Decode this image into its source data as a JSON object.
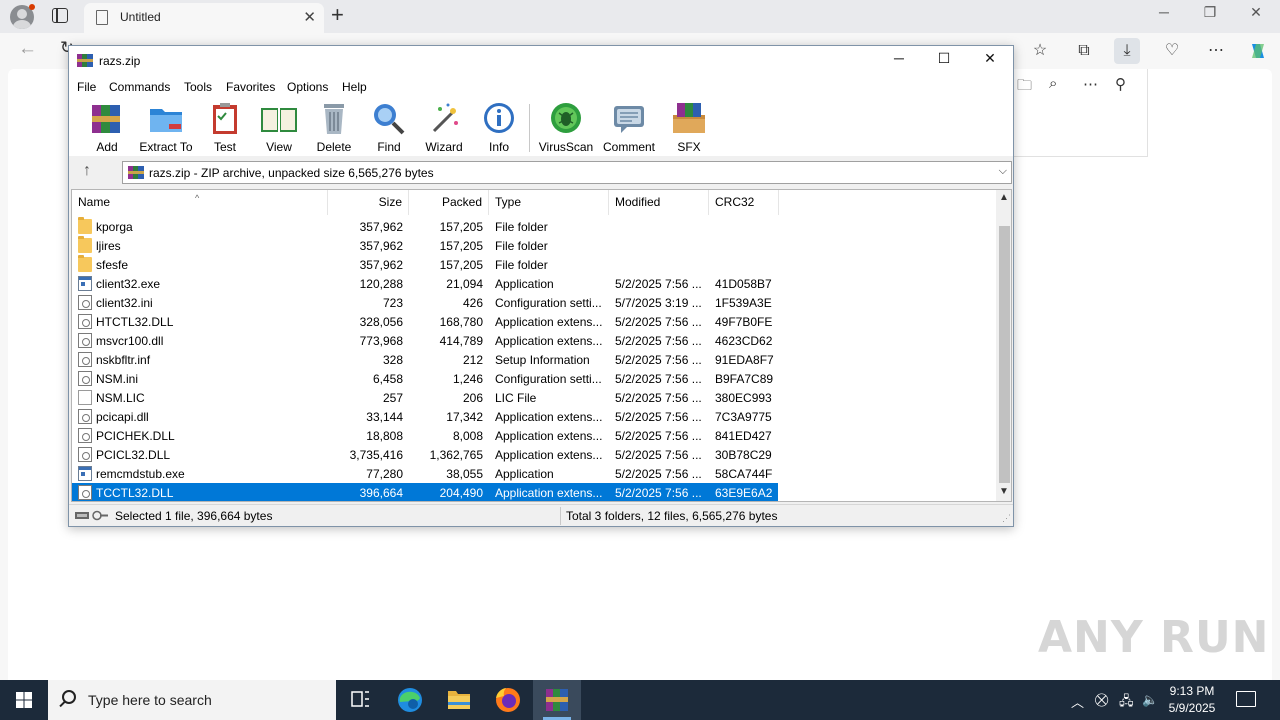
{
  "browser": {
    "tab_title": "Untitled",
    "tab_close": "✕",
    "new_tab": "+",
    "min": "─",
    "max": "❐",
    "close": "✕",
    "back": "←",
    "refresh": "↻"
  },
  "winrar": {
    "title": "razs.zip",
    "window_controls": {
      "minimize": "─",
      "maximize": "☐",
      "close": "✕"
    },
    "menu": [
      "File",
      "Commands",
      "Tools",
      "Favorites",
      "Options",
      "Help"
    ],
    "toolbar": [
      "Add",
      "Extract To",
      "Test",
      "View",
      "Delete",
      "Find",
      "Wizard",
      "Info",
      "VirusScan",
      "Comment",
      "SFX"
    ],
    "path": "razs.zip - ZIP archive, unpacked size 6,565,276 bytes",
    "columns": [
      "Name",
      "Size",
      "Packed",
      "Type",
      "Modified",
      "CRC32"
    ],
    "rows": [
      {
        "icon": "folder-icon",
        "name": "kporga",
        "size": "357,962",
        "packed": "157,205",
        "type": "File folder",
        "modified": "",
        "crc": ""
      },
      {
        "icon": "folder-icon",
        "name": "ljires",
        "size": "357,962",
        "packed": "157,205",
        "type": "File folder",
        "modified": "",
        "crc": ""
      },
      {
        "icon": "folder-icon",
        "name": "sfesfe",
        "size": "357,962",
        "packed": "157,205",
        "type": "File folder",
        "modified": "",
        "crc": ""
      },
      {
        "icon": "application-icon",
        "name": "client32.exe",
        "size": "120,288",
        "packed": "21,094",
        "type": "Application",
        "modified": "5/2/2025 7:56 ...",
        "crc": "41D058B7"
      },
      {
        "icon": "config-file-icon",
        "name": "client32.ini",
        "size": "723",
        "packed": "426",
        "type": "Configuration setti...",
        "modified": "5/7/2025 3:19 ...",
        "crc": "1F539A3E"
      },
      {
        "icon": "dll-file-icon",
        "name": "HTCTL32.DLL",
        "size": "328,056",
        "packed": "168,780",
        "type": "Application extens...",
        "modified": "5/2/2025 7:56 ...",
        "crc": "49F7B0FE"
      },
      {
        "icon": "dll-file-icon",
        "name": "msvcr100.dll",
        "size": "773,968",
        "packed": "414,789",
        "type": "Application extens...",
        "modified": "5/2/2025 7:56 ...",
        "crc": "4623CD62"
      },
      {
        "icon": "config-file-icon",
        "name": "nskbfltr.inf",
        "size": "328",
        "packed": "212",
        "type": "Setup Information",
        "modified": "5/2/2025 7:56 ...",
        "crc": "91EDA8F7"
      },
      {
        "icon": "config-file-icon",
        "name": "NSM.ini",
        "size": "6,458",
        "packed": "1,246",
        "type": "Configuration setti...",
        "modified": "5/2/2025 7:56 ...",
        "crc": "B9FA7C89"
      },
      {
        "icon": "blank-file-icon",
        "name": "NSM.LIC",
        "size": "257",
        "packed": "206",
        "type": "LIC File",
        "modified": "5/2/2025 7:56 ...",
        "crc": "380EC993"
      },
      {
        "icon": "dll-file-icon",
        "name": "pcicapi.dll",
        "size": "33,144",
        "packed": "17,342",
        "type": "Application extens...",
        "modified": "5/2/2025 7:56 ...",
        "crc": "7C3A9775"
      },
      {
        "icon": "dll-file-icon",
        "name": "PCICHEK.DLL",
        "size": "18,808",
        "packed": "8,008",
        "type": "Application extens...",
        "modified": "5/2/2025 7:56 ...",
        "crc": "841ED427"
      },
      {
        "icon": "dll-file-icon",
        "name": "PCICL32.DLL",
        "size": "3,735,416",
        "packed": "1,362,765",
        "type": "Application extens...",
        "modified": "5/2/2025 7:56 ...",
        "crc": "30B78C29"
      },
      {
        "icon": "application-icon",
        "name": "remcmdstub.exe",
        "size": "77,280",
        "packed": "38,055",
        "type": "Application",
        "modified": "5/2/2025 7:56 ...",
        "crc": "58CA744F"
      },
      {
        "icon": "dll-file-icon",
        "name": "TCCTL32.DLL",
        "size": "396,664",
        "packed": "204,490",
        "type": "Application extens...",
        "modified": "5/2/2025 7:56 ...",
        "crc": "63E9E6A2",
        "selected": true
      }
    ],
    "status_left": "Selected 1 file, 396,664 bytes",
    "status_right": "Total 3 folders, 12 files, 6,565,276 bytes",
    "selection_color": "#0078d7"
  },
  "watermark": "ANY RUN",
  "taskbar": {
    "search_placeholder": "Type here to search",
    "time": "9:13 PM",
    "date": "5/9/2025",
    "apps": [
      "task-view-icon",
      "edge-icon",
      "file-explorer-icon",
      "firefox-icon",
      "winrar-icon"
    ]
  }
}
